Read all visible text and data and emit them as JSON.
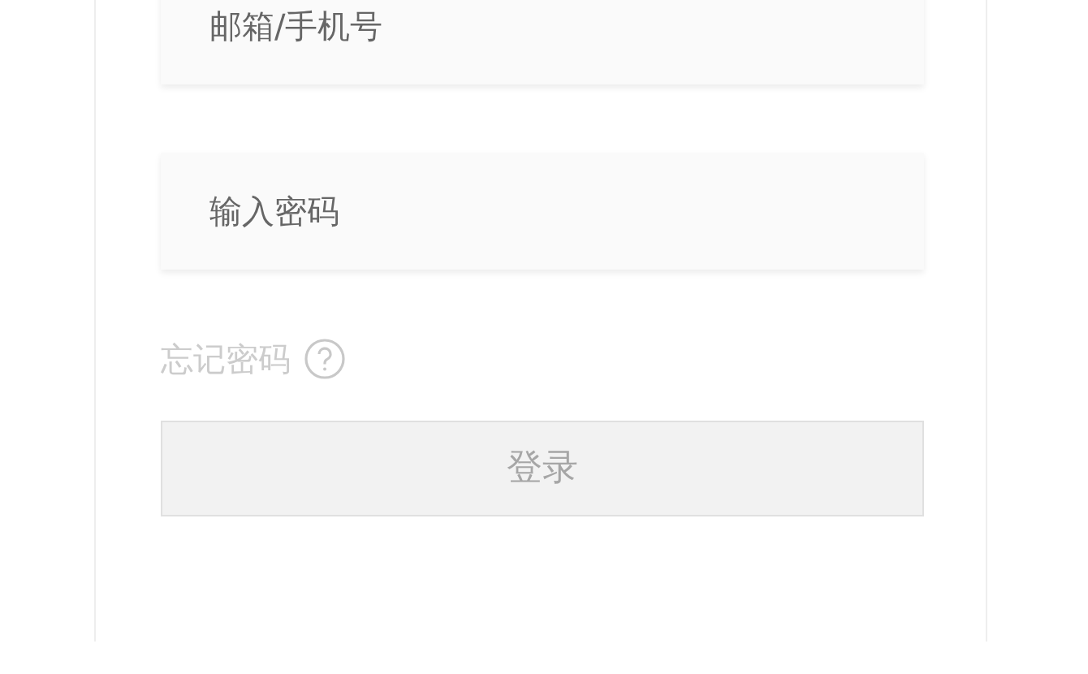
{
  "fields": [
    {
      "placeholder": "邮箱/手机号"
    },
    {
      "placeholder": "输入密码"
    }
  ],
  "forgot_password": {
    "label": "忘记密码"
  },
  "login_button": {
    "label": "登录",
    "disabled": true
  }
}
